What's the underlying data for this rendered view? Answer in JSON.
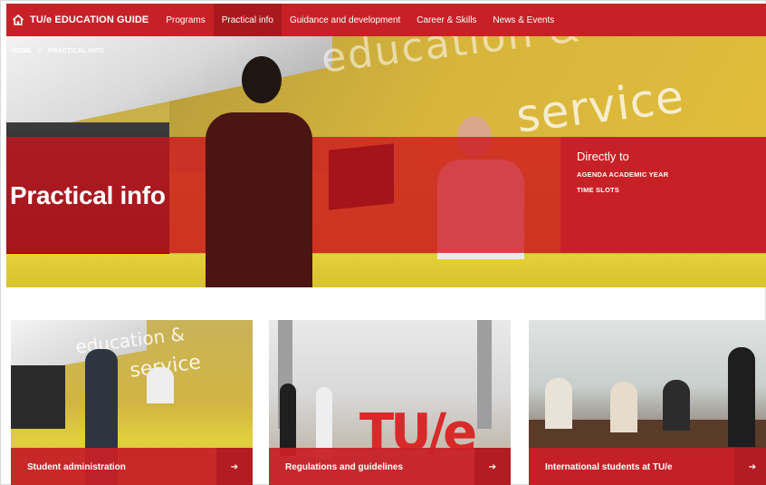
{
  "nav": {
    "brand": "TU/e EDUCATION GUIDE",
    "items": [
      {
        "label": "Programs",
        "active": false
      },
      {
        "label": "Practical info",
        "active": true
      },
      {
        "label": "Guidance and development",
        "active": false
      },
      {
        "label": "Career & Skills",
        "active": false
      },
      {
        "label": "News & Events",
        "active": false
      }
    ]
  },
  "hero": {
    "breadcrumb": [
      "HOME",
      "PRACTICAL INFO"
    ],
    "breadcrumb_sep": "/",
    "title": "Practical info",
    "wall_text_1": "education &",
    "wall_text_2": "service"
  },
  "directly": {
    "title": "Directly to",
    "links": [
      "AGENDA ACADEMIC YEAR",
      "TIME SLOTS"
    ]
  },
  "cards": [
    {
      "label": "Student administration",
      "arrow": "➔",
      "photo_text_1": "education &",
      "photo_text_2": "service"
    },
    {
      "label": "Regulations and guidelines",
      "arrow": "➔",
      "photo_text": "TU/e"
    },
    {
      "label": "International students at TU/e",
      "arrow": "➔"
    }
  ],
  "colors": {
    "brand_red": "#c72127",
    "brand_red_dark": "#a8191e",
    "accent_yellow": "#e1cf3d"
  },
  "icons": {
    "home": "home-icon",
    "arrow": "arrow-right-icon"
  }
}
